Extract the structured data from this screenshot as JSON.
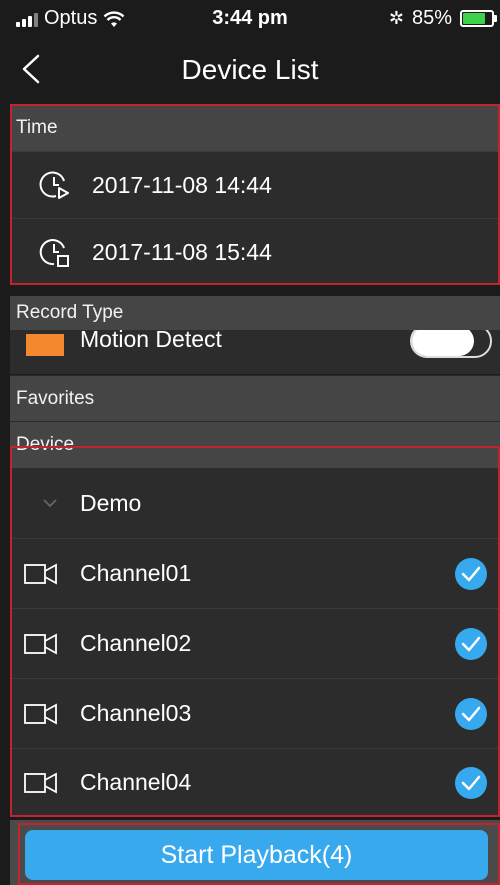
{
  "status_bar": {
    "carrier": "Optus",
    "time": "3:44 pm",
    "battery": "85%",
    "battery_level": 0.85
  },
  "nav": {
    "title": "Device List"
  },
  "time_section": {
    "header": "Time",
    "start_time": "2017-11-08 14:44",
    "end_time": "2017-11-08 15:44"
  },
  "record_type": {
    "header": "Record Type",
    "item_label": "Motion Detect",
    "item_color": "#f2892e",
    "enabled": false
  },
  "favorites": {
    "header": "Favorites"
  },
  "device_section": {
    "header": "Device",
    "group": "Demo",
    "channels": [
      {
        "label": "Channel01",
        "checked": true
      },
      {
        "label": "Channel02",
        "checked": true
      },
      {
        "label": "Channel03",
        "checked": true
      },
      {
        "label": "Channel04",
        "checked": true
      }
    ]
  },
  "footer": {
    "button_label": "Start Playback(4)"
  },
  "colors": {
    "accent": "#39a9ee",
    "highlight_border": "#c3232e"
  }
}
